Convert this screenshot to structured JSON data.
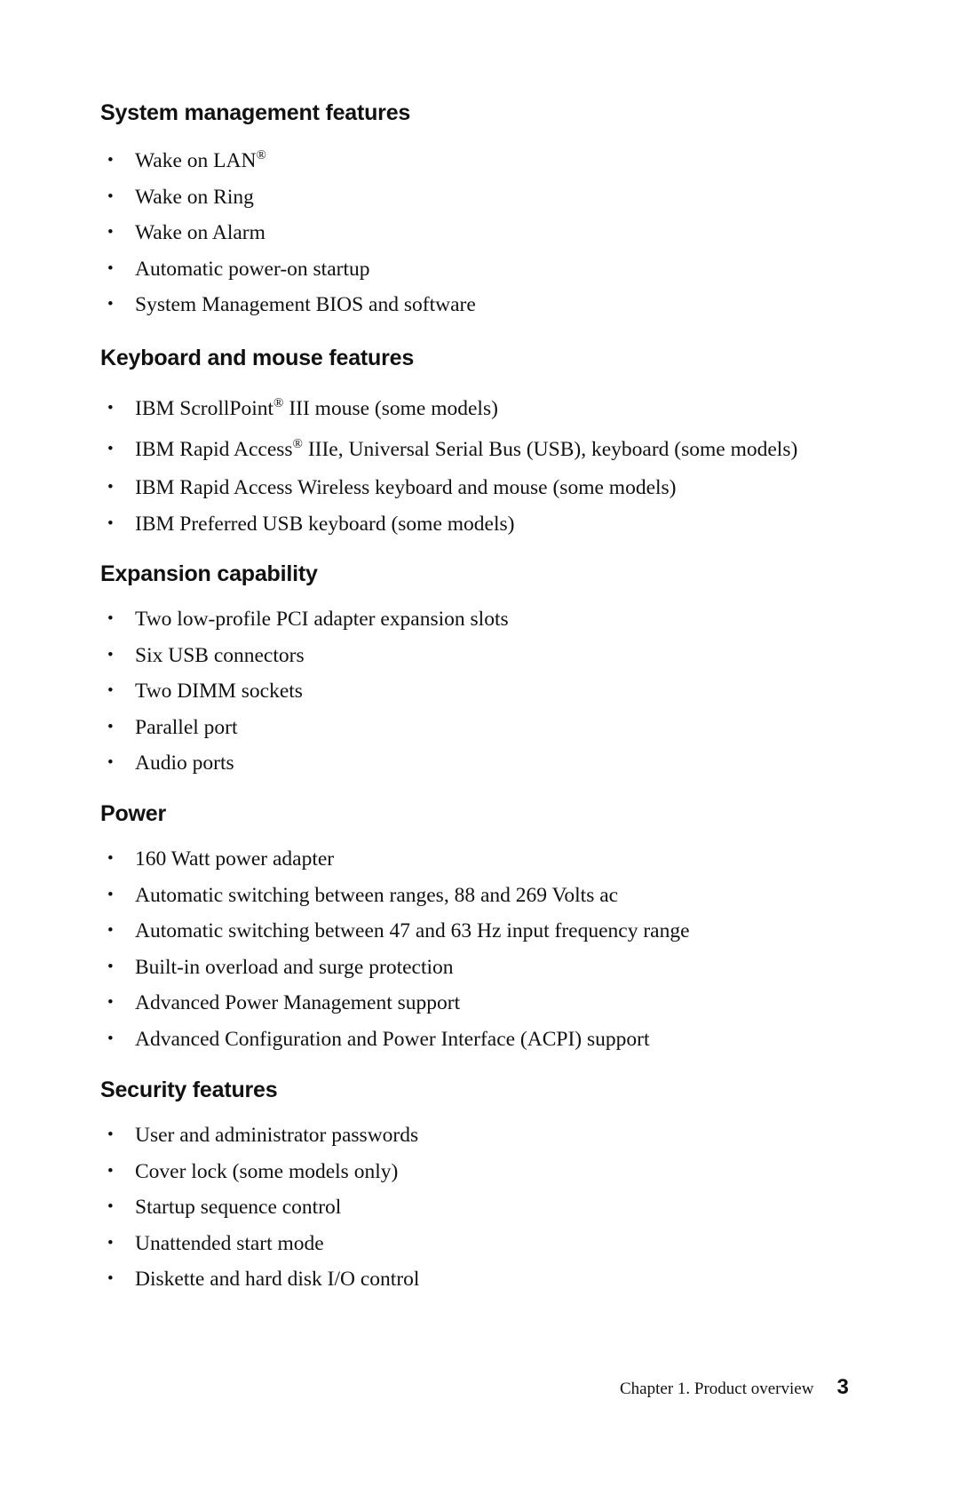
{
  "sections": [
    {
      "title": "System management features",
      "items": [
        {
          "text": "Wake on LAN",
          "sup": "®",
          "rest": ""
        },
        {
          "text": "Wake on Ring"
        },
        {
          "text": "Wake on Alarm"
        },
        {
          "text": "Automatic power-on startup"
        },
        {
          "text": "System Management BIOS and software"
        }
      ]
    },
    {
      "title": "Keyboard and mouse features",
      "items": [
        {
          "text": "IBM ScrollPoint",
          "sup": "®",
          "rest": " III mouse (some models)"
        },
        {
          "text": "IBM Rapid Access",
          "sup": "®",
          "rest": " IIIe, Universal Serial Bus (USB), keyboard (some models)"
        },
        {
          "text": "IBM Rapid Access Wireless keyboard and mouse (some models)"
        },
        {
          "text": "IBM Preferred USB keyboard (some models)"
        }
      ]
    },
    {
      "title": "Expansion capability",
      "items": [
        {
          "text": "Two low-profile PCI adapter expansion slots"
        },
        {
          "text": "Six USB connectors"
        },
        {
          "text": "Two DIMM sockets"
        },
        {
          "text": "Parallel port"
        },
        {
          "text": "Audio ports"
        }
      ]
    },
    {
      "title": "Power",
      "items": [
        {
          "text": "160 Watt power adapter"
        },
        {
          "text": "Automatic switching between ranges, 88 and 269 Volts ac"
        },
        {
          "text": "Automatic switching between 47 and 63 Hz input frequency range"
        },
        {
          "text": "Built-in overload and surge protection"
        },
        {
          "text": "Advanced Power Management support"
        },
        {
          "text": "Advanced Configuration and Power Interface (ACPI) support"
        }
      ]
    },
    {
      "title": "Security features",
      "items": [
        {
          "text": "User and administrator passwords"
        },
        {
          "text": "Cover lock (some models only)"
        },
        {
          "text": "Startup sequence control"
        },
        {
          "text": "Unattended start mode"
        },
        {
          "text": "Diskette and hard disk I/O control"
        }
      ]
    }
  ],
  "bullet_glyph": "•",
  "footer": {
    "chapter": "Chapter 1.  Product overview",
    "page_number": "3"
  }
}
